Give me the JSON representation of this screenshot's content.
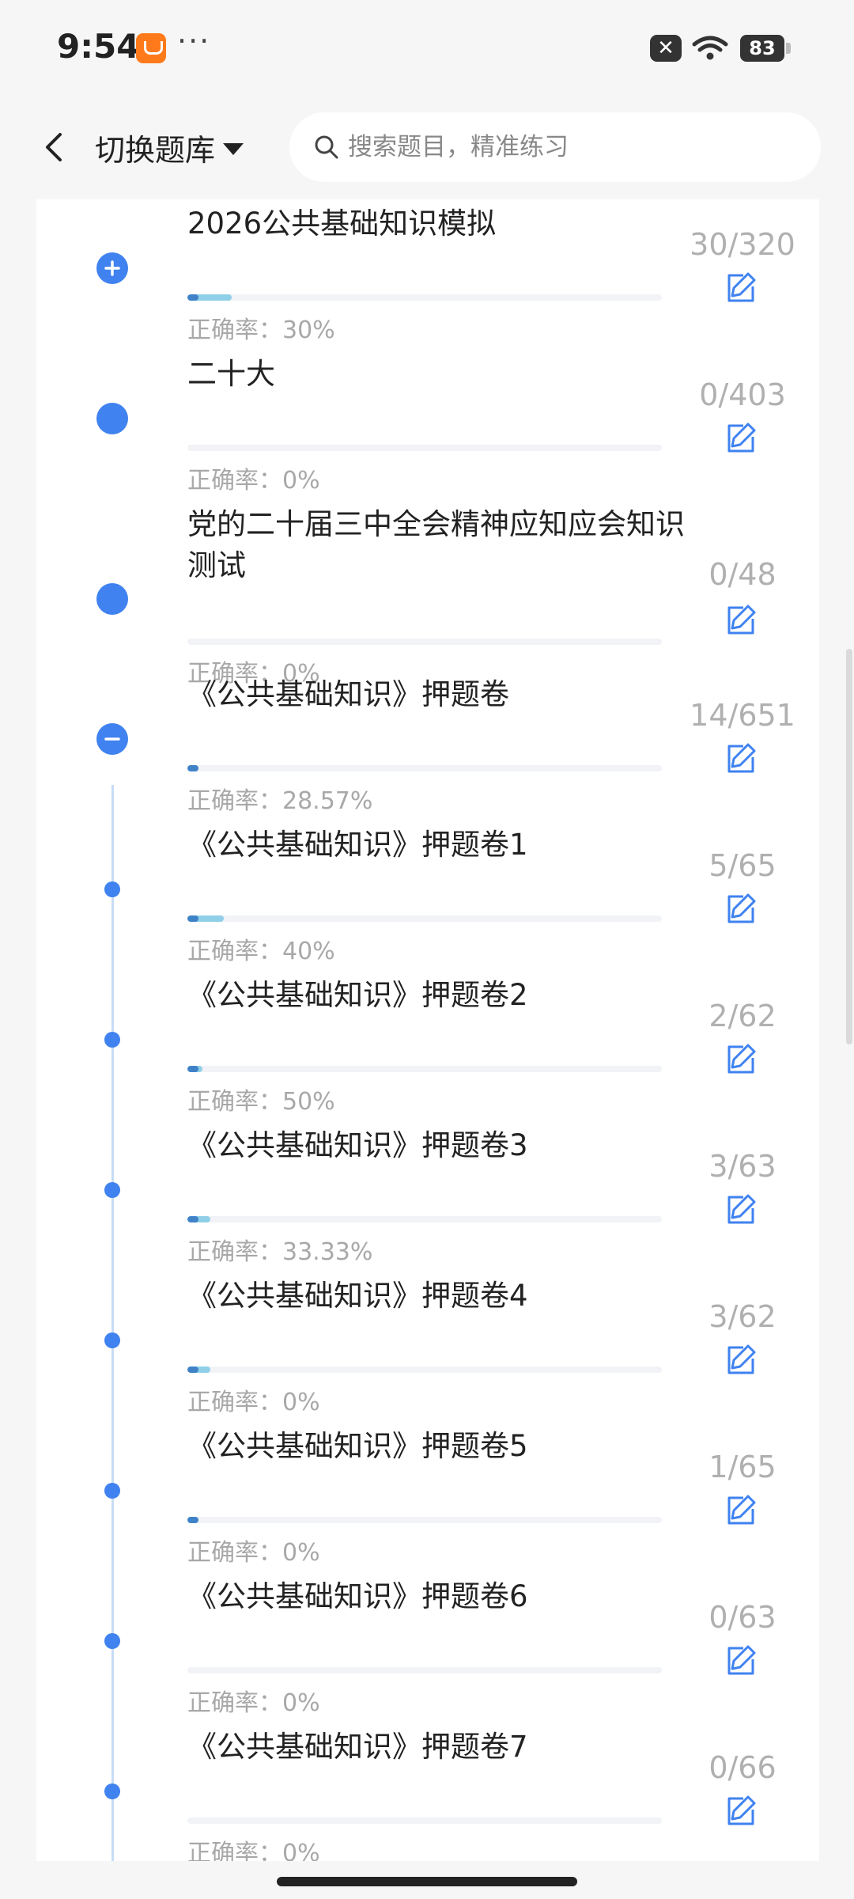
{
  "status_bar": {
    "time": "9:54",
    "overflow": "···",
    "x_badge": "✕",
    "battery": "83"
  },
  "header": {
    "switch_label": "切换题库",
    "search_placeholder": "搜索题目，精准练习"
  },
  "accuracy_prefix": "正确率：",
  "rows": [
    {
      "title": "2026公共基础知识模拟",
      "accuracy": "30%",
      "count": "30/320",
      "progress": 0.094,
      "node": "expand"
    },
    {
      "title": "二十大",
      "accuracy": "0%",
      "count": "0/403",
      "progress": 0,
      "node": "dot"
    },
    {
      "title": "党的二十届三中全会精神应知应会知识测试",
      "accuracy": "0%",
      "count": "0/48",
      "progress": 0,
      "node": "dot"
    },
    {
      "title": "《公共基础知识》押题卷",
      "accuracy": "28.57%",
      "count": "14/651",
      "progress": 0.022,
      "node": "collapse"
    },
    {
      "title": "《公共基础知识》押题卷1",
      "accuracy": "40%",
      "count": "5/65",
      "progress": 0.077,
      "node": "child"
    },
    {
      "title": "《公共基础知识》押题卷2",
      "accuracy": "50%",
      "count": "2/62",
      "progress": 0.032,
      "node": "child"
    },
    {
      "title": "《公共基础知识》押题卷3",
      "accuracy": "33.33%",
      "count": "3/63",
      "progress": 0.048,
      "node": "child"
    },
    {
      "title": "《公共基础知识》押题卷4",
      "accuracy": "0%",
      "count": "3/62",
      "progress": 0.048,
      "node": "child"
    },
    {
      "title": "《公共基础知识》押题卷5",
      "accuracy": "0%",
      "count": "1/65",
      "progress": 0.015,
      "node": "child"
    },
    {
      "title": "《公共基础知识》押题卷6",
      "accuracy": "0%",
      "count": "0/63",
      "progress": 0,
      "node": "child"
    },
    {
      "title": "《公共基础知识》押题卷7",
      "accuracy": "0%",
      "count": "0/66",
      "progress": 0,
      "node": "child"
    }
  ],
  "colors": {
    "accent": "#3f82f0",
    "progress": "#8fd0e8",
    "muted": "#a8a8a8"
  }
}
